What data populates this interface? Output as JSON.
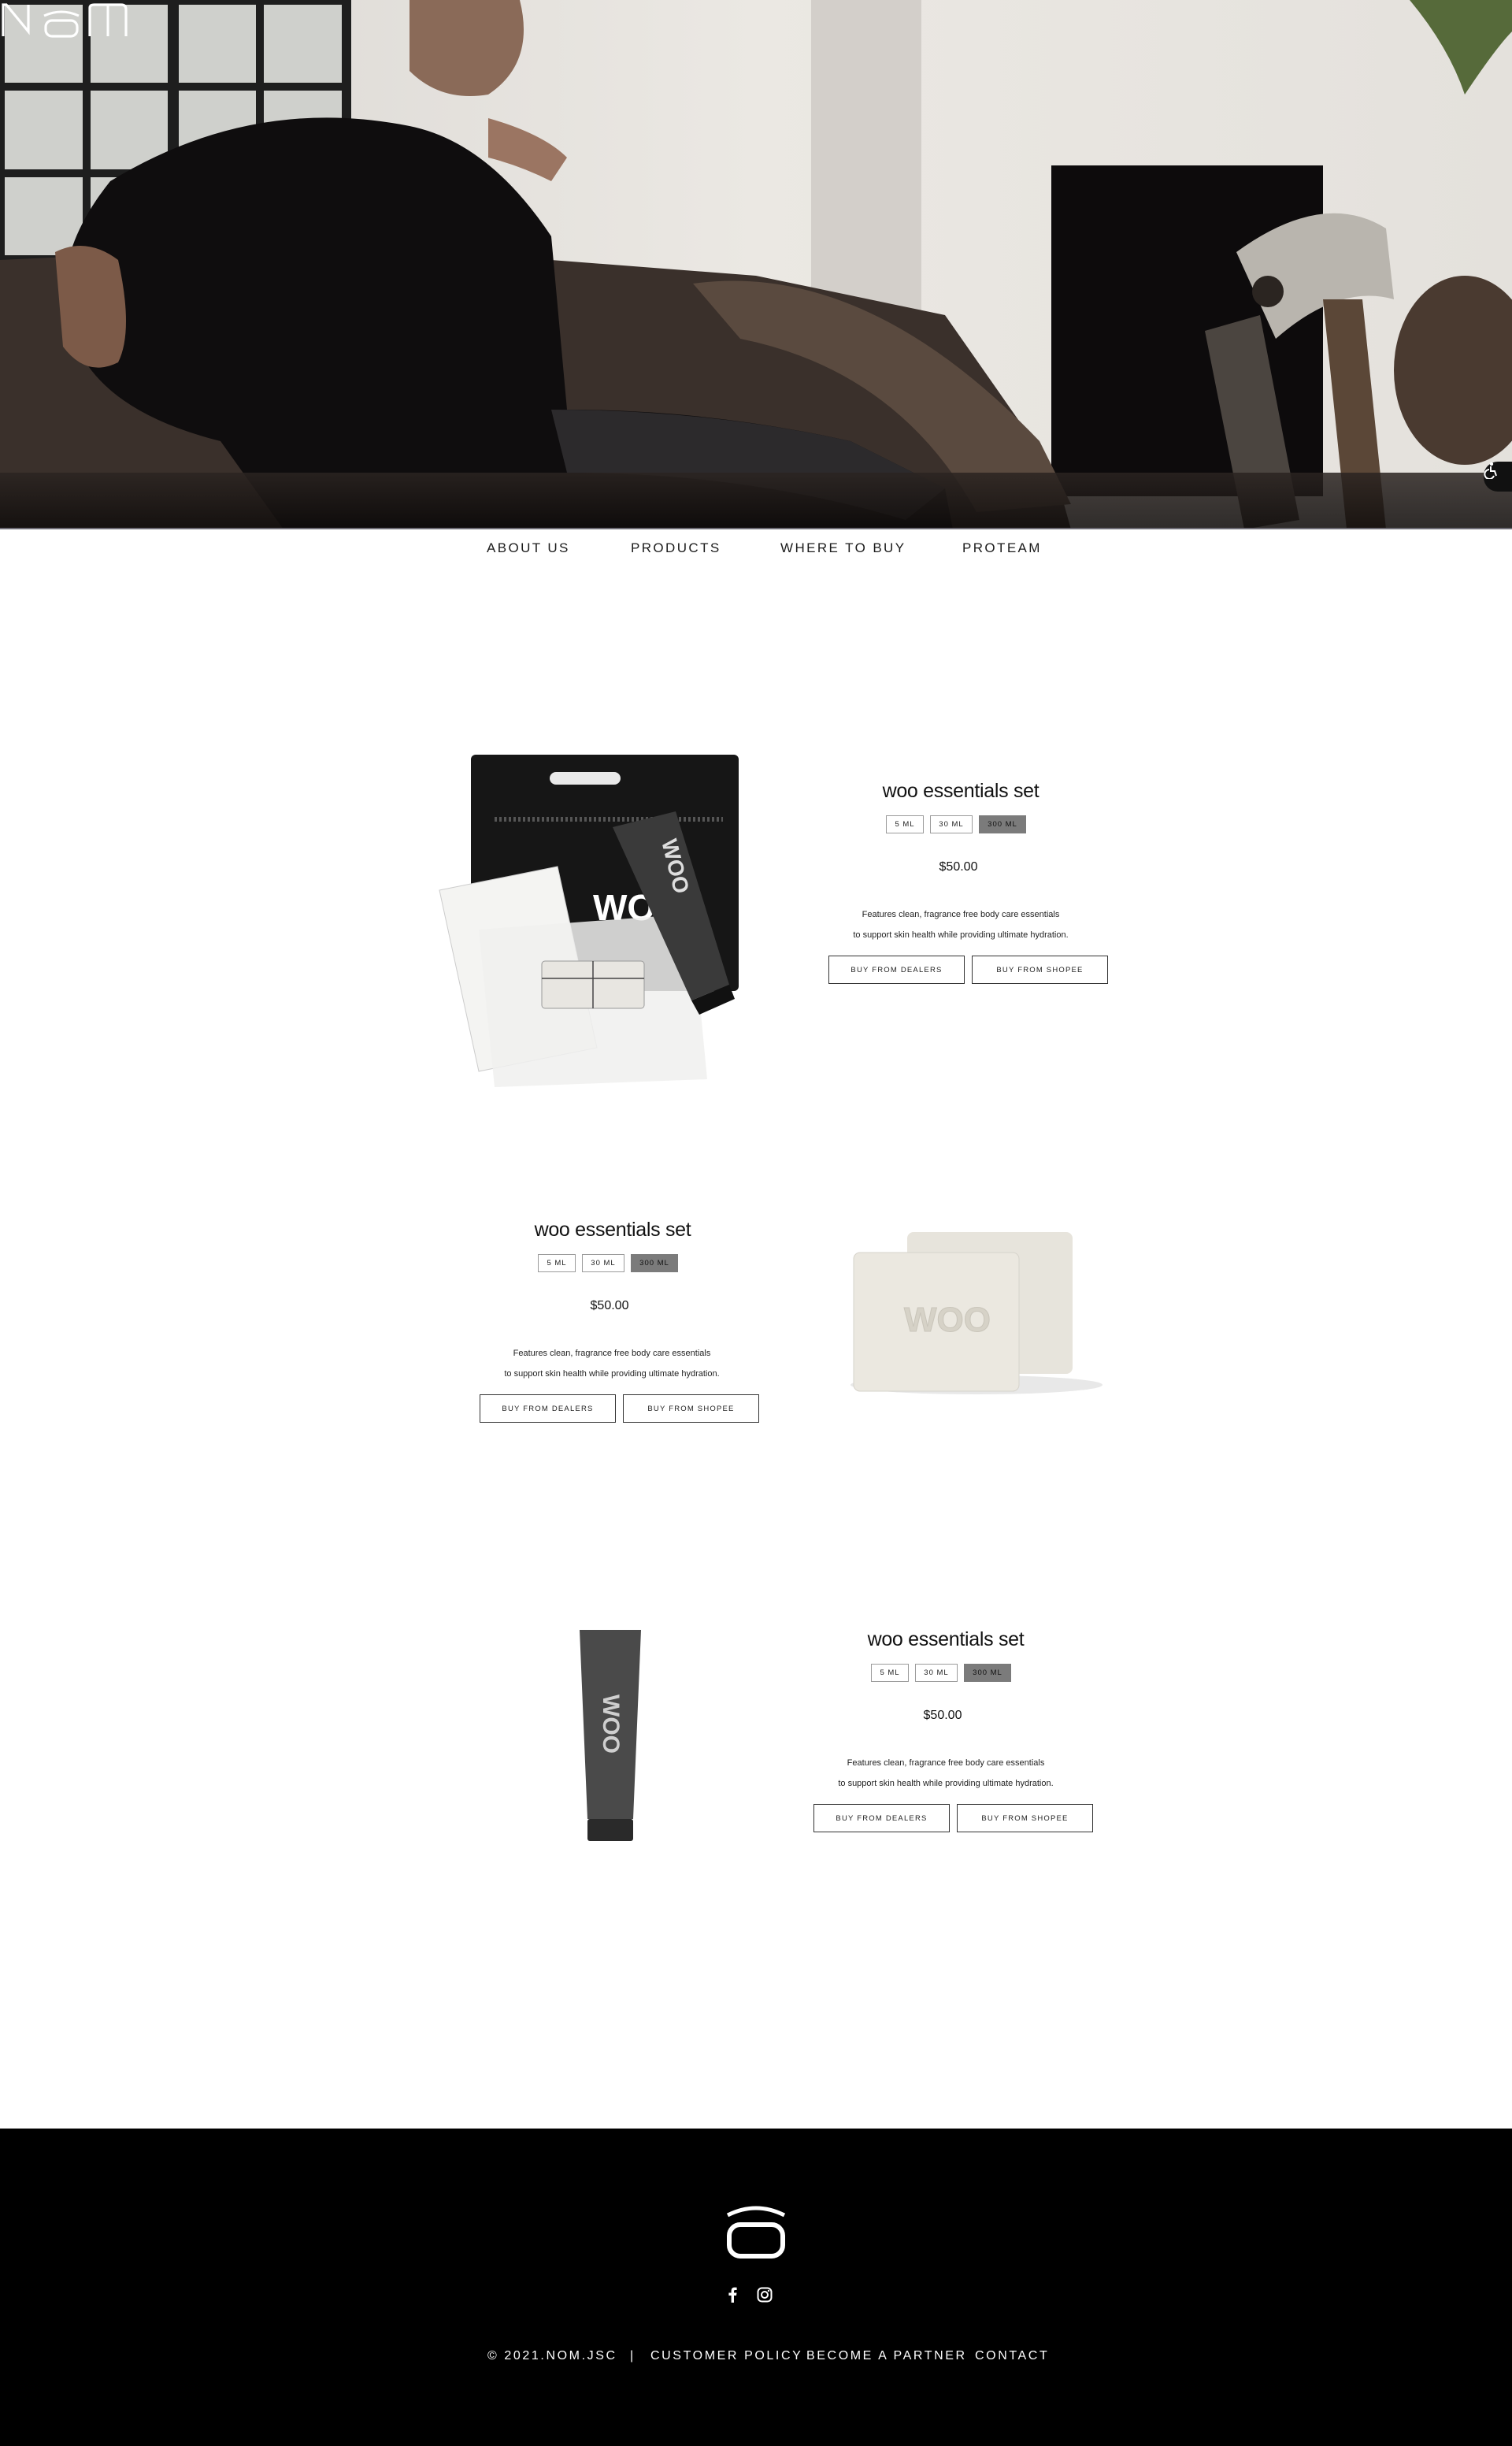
{
  "brand": {
    "logo_text": "NOM"
  },
  "nav": {
    "items": [
      {
        "label": "ABOUT US"
      },
      {
        "label": "PRODUCTS"
      },
      {
        "label": "WHERE TO BUY"
      },
      {
        "label": "PROTEAM"
      }
    ]
  },
  "products": [
    {
      "title": "woo essentials set",
      "sizes": [
        "5 ML",
        "30 ML",
        "300 ML"
      ],
      "selected_size": "300 ML",
      "price": "$50.00",
      "description_line1": "Features clean, fragrance free body care essentials",
      "description_line2": "to support skin health while providing ultimate hydration.",
      "buy_dealers_label": "BUY FROM DEALERS",
      "buy_shopee_label": "BUY FROM SHOPEE",
      "image_text": "WOO"
    },
    {
      "title": "woo essentials set",
      "sizes": [
        "5 ML",
        "30 ML",
        "300 ML"
      ],
      "selected_size": "300 ML",
      "price": "$50.00",
      "description_line1": "Features clean, fragrance free body care essentials",
      "description_line2": "to support skin health while providing ultimate hydration.",
      "buy_dealers_label": "BUY FROM DEALERS",
      "buy_shopee_label": "BUY FROM SHOPEE",
      "image_text": "WOO"
    },
    {
      "title": "woo essentials set",
      "sizes": [
        "5 ML",
        "30 ML",
        "300 ML"
      ],
      "selected_size": "300 ML",
      "price": "$50.00",
      "description_line1": "Features clean, fragrance free body care essentials",
      "description_line2": "to support skin health while providing ultimate hydration.",
      "buy_dealers_label": "BUY FROM DEALERS",
      "buy_shopee_label": "BUY FROM SHOPEE",
      "image_text": "WOO"
    }
  ],
  "footer": {
    "copyright": "© 2021.NOM.JSC",
    "separator": "|",
    "customer_policy": "CUSTOMER POLICY",
    "become_partner": "BECOME A PARTNER",
    "contact": "CONTACT",
    "social_icons": [
      "facebook-icon",
      "instagram-icon"
    ]
  },
  "colors": {
    "footer_bg": "#000000",
    "active_size_bg": "#7b7b7b",
    "hero_line": "#6e6c75"
  }
}
